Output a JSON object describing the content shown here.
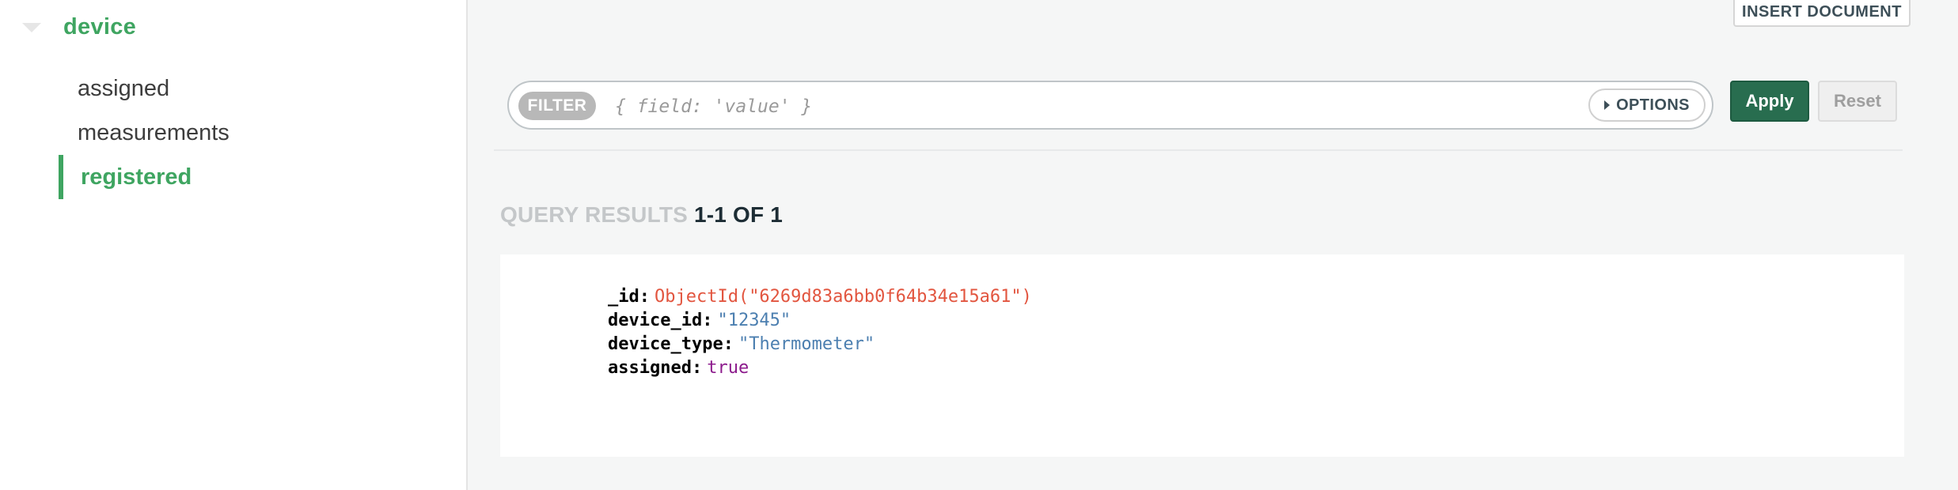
{
  "sidebar": {
    "database": "device",
    "collections": [
      {
        "label": "assigned",
        "active": false
      },
      {
        "label": "measurements",
        "active": false
      },
      {
        "label": "registered",
        "active": true
      }
    ]
  },
  "toolbar": {
    "insert_document_label": "INSERT DOCUMENT"
  },
  "filter": {
    "pill_label": "FILTER",
    "placeholder": "{ field: 'value' }",
    "value": "",
    "options_label": "OPTIONS",
    "apply_label": "Apply",
    "reset_label": "Reset"
  },
  "results": {
    "header_label": "QUERY RESULTS",
    "count_label": "1-1 OF 1"
  },
  "document": {
    "fields": [
      {
        "key": "_id:",
        "value": "ObjectId(\"6269d83a6bb0f64b34e15a61\")",
        "type": "oid"
      },
      {
        "key": "device_id:",
        "value": "\"12345\"",
        "type": "string"
      },
      {
        "key": "device_type:",
        "value": "\"Thermometer\"",
        "type": "string"
      },
      {
        "key": "assigned:",
        "value": "true",
        "type": "bool"
      }
    ]
  },
  "colors": {
    "accent_green": "#3fa561",
    "apply_green": "#286d4f",
    "objectid": "#e2553f",
    "string": "#4c7fb0",
    "bool": "#8c1a8c"
  }
}
